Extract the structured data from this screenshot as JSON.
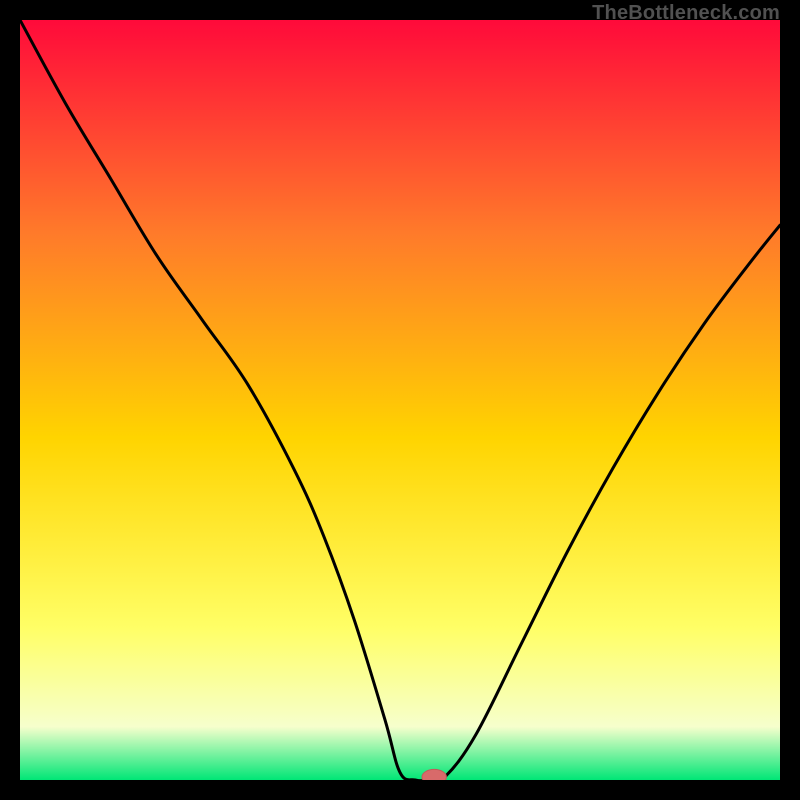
{
  "watermark": "TheBottleneck.com",
  "colors": {
    "bg": "#000000",
    "grad_top": "#ff0a3a",
    "grad_mid1": "#ff7a2a",
    "grad_mid2": "#ffd400",
    "grad_low1": "#ffff66",
    "grad_low2": "#f6ffcc",
    "grad_bottom": "#00e676",
    "curve": "#000000",
    "marker_fill": "#d86a6a",
    "marker_stroke": "#c45a5a"
  },
  "chart_data": {
    "type": "line",
    "title": "",
    "xlabel": "",
    "ylabel": "",
    "xlim": [
      0,
      100
    ],
    "ylim": [
      0,
      100
    ],
    "x": [
      0,
      6,
      12,
      18,
      24,
      30,
      36,
      40,
      44,
      48,
      50,
      52,
      54,
      56,
      60,
      66,
      72,
      78,
      84,
      90,
      96,
      100
    ],
    "values": [
      100,
      89,
      79,
      69,
      60.5,
      52,
      41,
      32,
      21,
      8,
      1,
      0,
      0,
      0.5,
      6,
      18,
      30,
      41,
      51,
      60,
      68,
      73
    ],
    "marker": {
      "x": 54.5,
      "y": 0.4,
      "rx": 1.6,
      "ry": 1.0
    },
    "notes": "x and y in 0–100 of plot area; y=0 at bottom (green), y=100 at top (red). Curve is a V with minimum near x≈53, flat floor 50–56, left branch steeper with slight knee near x≈30, right branch rises to ≈73."
  }
}
